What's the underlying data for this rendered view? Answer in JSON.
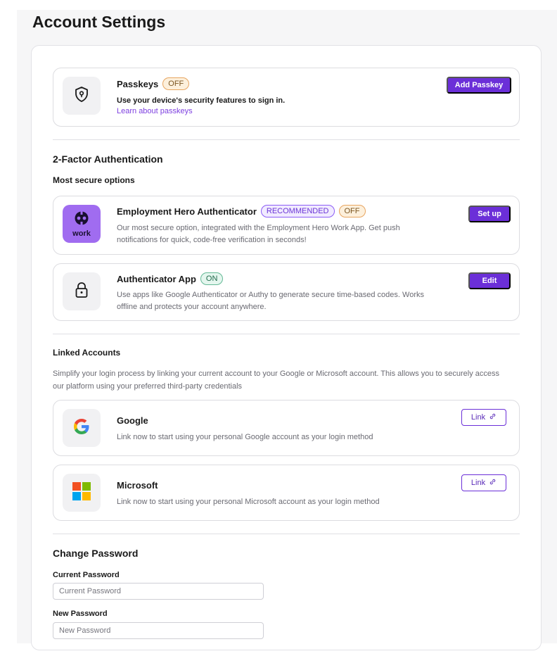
{
  "page": {
    "title": "Account Settings"
  },
  "passkeys": {
    "title": "Passkeys",
    "status": "OFF",
    "description": "Use your device's security features to sign in.",
    "learn_link": "Learn about passkeys",
    "button": "Add Passkey",
    "icon": "shield-keyhole-icon"
  },
  "two_factor": {
    "title": "2-Factor Authentication",
    "subtitle": "Most secure options",
    "eh_auth": {
      "title": "Employment Hero Authenticator",
      "badge_recommended": "RECOMMENDED",
      "status": "OFF",
      "description_line1": "Our most secure option, integrated with the Employment Hero Work App. Get push",
      "description_line2": "notifications for quick, code-free verification in seconds!",
      "button": "Set up",
      "logo_text": "work"
    },
    "auth_app": {
      "title": "Authenticator App",
      "status": "ON",
      "description_line1": "Use apps like Google Authenticator or Authy to generate secure time-based codes. Works",
      "description_line2": "offline and protects your account anywhere.",
      "button": "Edit",
      "icon": "padlock-icon"
    }
  },
  "linked_accounts": {
    "title": "Linked Accounts",
    "description_line1": "Simplify your login process by linking your current account to your Google or Microsoft account. This allows you to securely access",
    "description_line2": "our platform using your preferred third-party credentials",
    "google": {
      "title": "Google",
      "description": "Link now to start using your personal Google account as your login method",
      "button": "Link"
    },
    "microsoft": {
      "title": "Microsoft",
      "description": "Link now to start using your personal Microsoft account as your login method",
      "button": "Link"
    }
  },
  "change_password": {
    "title": "Change Password",
    "current_label": "Current Password",
    "current_placeholder": "Current Password",
    "new_label": "New Password",
    "new_placeholder": "New Password"
  },
  "colors": {
    "accent": "#6b2fd8",
    "off_badge": "#fdf0dc",
    "on_badge": "#e4f6ee",
    "recommended_badge": "#f1ebff"
  }
}
